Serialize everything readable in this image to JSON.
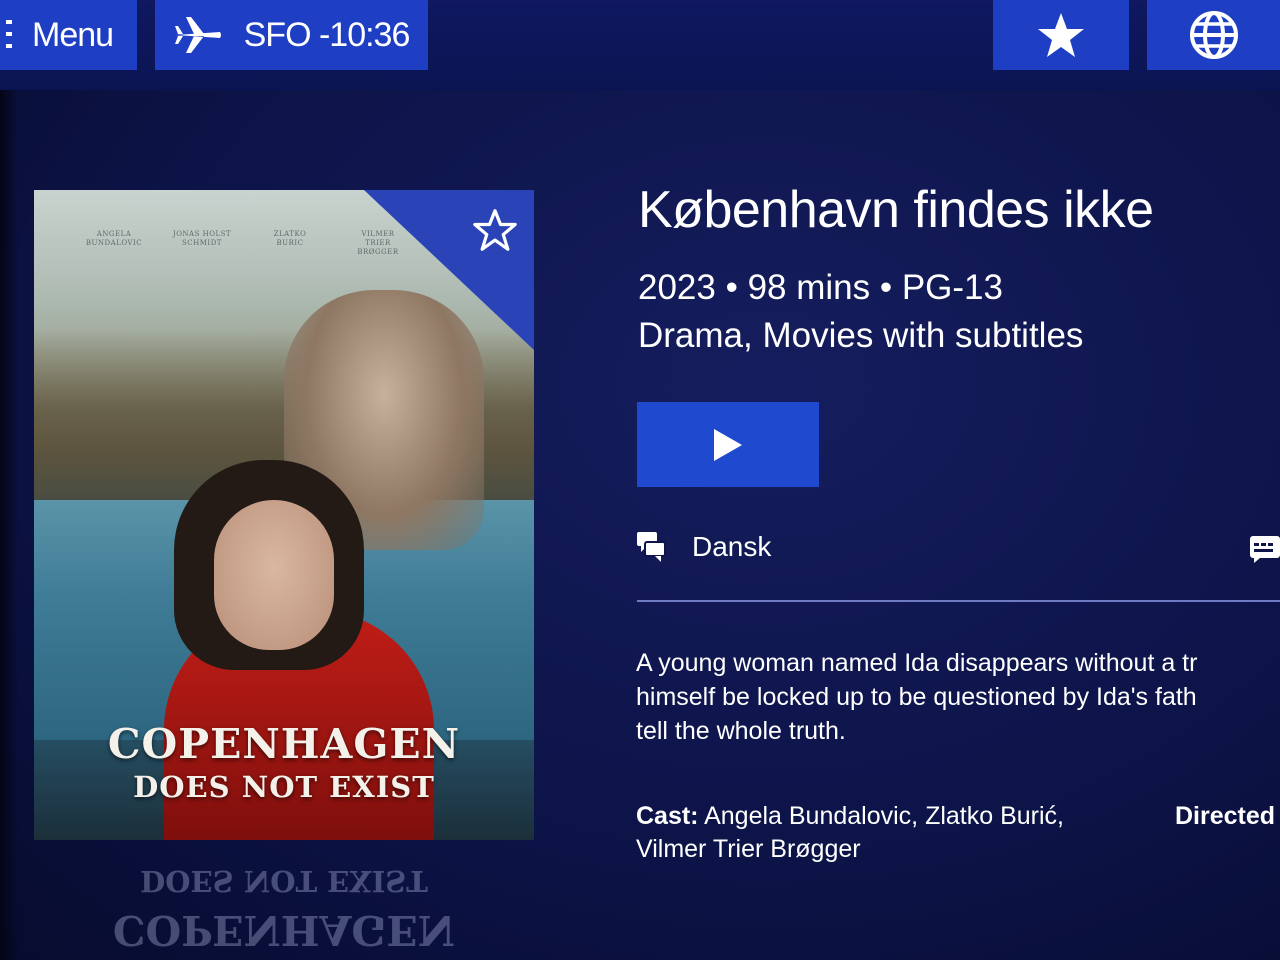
{
  "topbar": {
    "menu_label": "Menu",
    "flight_label": "SFO -10:36",
    "icons": [
      "menu-icon",
      "airplane-icon",
      "star-icon",
      "globe-icon"
    ]
  },
  "poster": {
    "credits": [
      "ANGELA BUNDALOVIC",
      "JONAS HOLST SCHMIDT",
      "ZLATKO BURIC",
      "VILMER TRIER BRØGGER"
    ],
    "title_line1": "COPENHAGEN",
    "title_line2": "DOES NOT EXIST"
  },
  "details": {
    "title": "København findes ikke",
    "meta": "2023 • 98 mins • PG-13",
    "genres": "Drama, Movies with subtitles",
    "audio_label": "Dansk",
    "description": "A young woman named Ida disappears without a tr\nhimself be locked up to be questioned by Ida's fath\ntell the whole truth.",
    "cast_label": "Cast:",
    "cast_value": " Angela Bundalovic, Zlatko Burić, Vilmer Trier Brøgger",
    "directed_label": "Directed"
  },
  "colors": {
    "background": "#0d1449",
    "topbar_button": "#1e3fc4",
    "play_button": "#1f4ad0",
    "divider": "#6e7bc4"
  }
}
